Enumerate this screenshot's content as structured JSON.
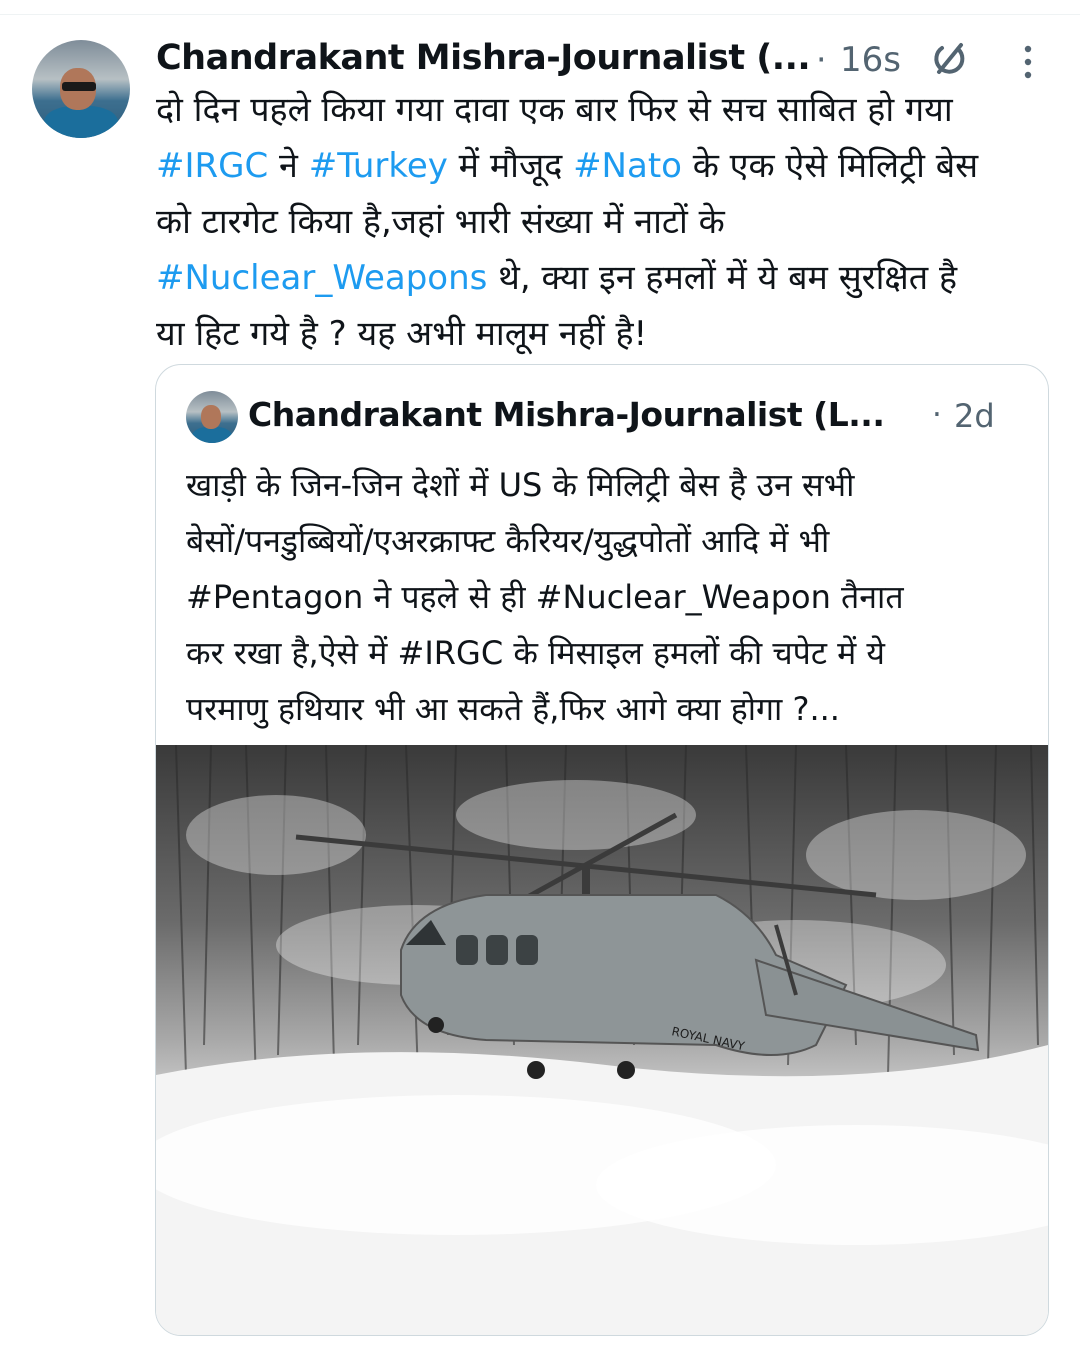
{
  "tweet": {
    "author": "Chandrakant Mishra-Journalist (...",
    "separator": "·",
    "time": "16s",
    "lines": [
      [
        {
          "t": "दो दिन पहले किया गया दावा एक बार फिर से सच साबित हो गया",
          "h": false
        }
      ],
      [
        {
          "t": "#IRGC",
          "h": true
        },
        {
          "t": " ने ",
          "h": false
        },
        {
          "t": "#Turkey",
          "h": true
        },
        {
          "t": " में मौजूद ",
          "h": false
        },
        {
          "t": "#Nato",
          "h": true
        },
        {
          "t": " के एक ऐसे मिलिट्री बेस",
          "h": false
        }
      ],
      [
        {
          "t": "को टारगेट किया है,जहां भारी संख्या में नाटों के",
          "h": false
        }
      ],
      [
        {
          "t": "#Nuclear_Weapons",
          "h": true
        },
        {
          "t": " थे, क्या इन हमलों में ये बम सुरक्षित है",
          "h": false
        }
      ],
      [
        {
          "t": "या हिट गये है ? यह अभी मालूम नहीं है!",
          "h": false
        }
      ]
    ]
  },
  "quoted": {
    "author": "Chandrakant Mishra-Journalist (L...",
    "separator": "·",
    "time": "2d",
    "lines": [
      "खाड़ी के जिन-जिन देशों में US के मिलिट्री बेस है उन सभी",
      "बेसों/पनडुब्बियों/एअरक्राफ्ट कैरियर/युद्धपोतों आदि में भी",
      "#Pentagon ने पहले से ही #Nuclear_Weapon तैनात",
      "कर रखा है,ऐसे में #IRGC के मिसाइल हमलों की चपेट में ये",
      "परमाणु हथियार भी आ सकते हैं,फिर आगे क्या होगा ?..."
    ],
    "image_caption": "ROYAL NAVY"
  },
  "icons": {
    "grok": "grok-icon",
    "more": "more-vertical-icon"
  },
  "colors": {
    "link": "#1d9bf0",
    "text": "#0f1419",
    "muted": "#536471",
    "border": "#cfd9de"
  }
}
